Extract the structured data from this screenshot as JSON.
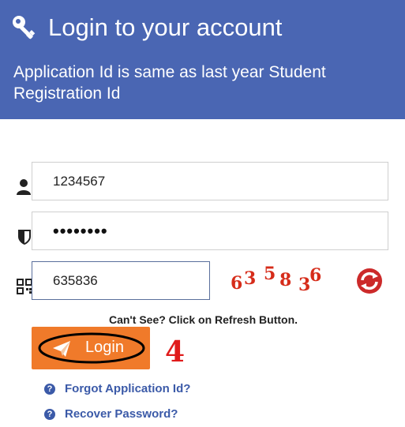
{
  "header": {
    "title": "Login to your account",
    "subtitle": "Application Id is same as last year Student Registration Id",
    "bg_color": "#4a66b3"
  },
  "form": {
    "application_id": {
      "value": "1234567",
      "icon": "user-icon"
    },
    "password": {
      "value": "••••••••",
      "icon": "shield-icon"
    },
    "captcha_input": {
      "value": "635836",
      "icon": "qr-code-icon"
    },
    "captcha_image": {
      "chars": [
        "6",
        "3",
        "5",
        "8",
        "3",
        "6"
      ],
      "color": "#d62c1a"
    },
    "refresh_icon": "refresh-icon"
  },
  "hint": "Can't See? Click on Refresh Button.",
  "login_button": {
    "label": "Login",
    "icon": "paper-plane-icon",
    "color": "#f07a2a"
  },
  "annotation": {
    "text": "4",
    "color": "#e01b1b"
  },
  "links": {
    "forgot": {
      "label": "Forgot Application Id?",
      "icon": "question-icon"
    },
    "recover": {
      "label": "Recover Password?",
      "icon": "question-icon"
    }
  }
}
